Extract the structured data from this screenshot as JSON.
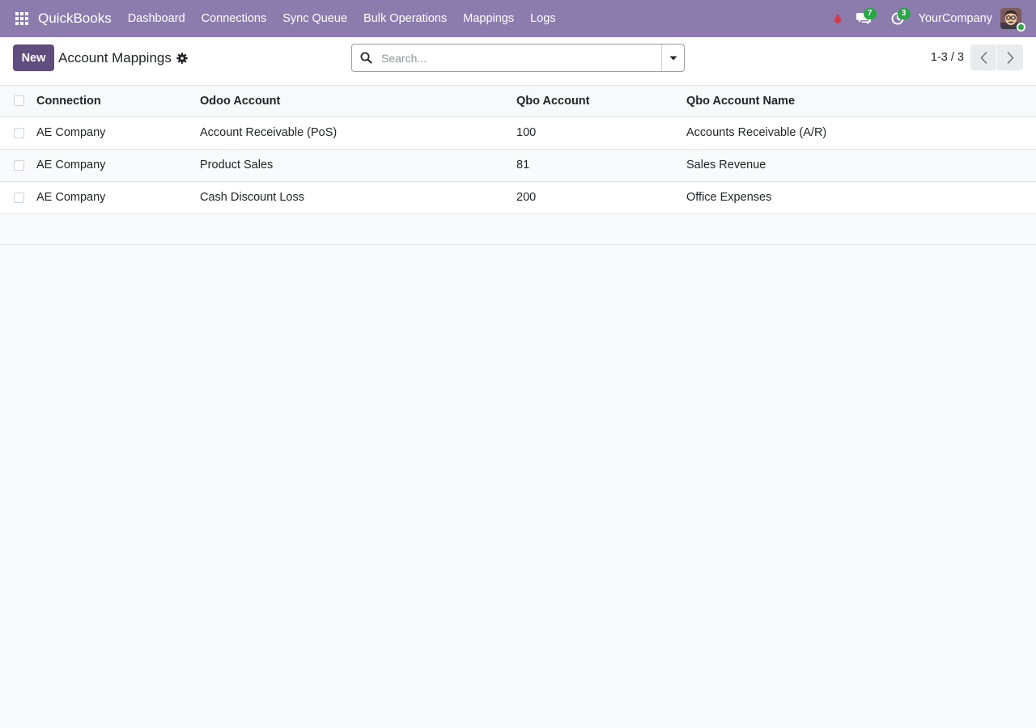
{
  "navbar": {
    "brand": "QuickBooks",
    "menu": [
      {
        "label": "Dashboard"
      },
      {
        "label": "Connections"
      },
      {
        "label": "Sync Queue"
      },
      {
        "label": "Bulk Operations"
      },
      {
        "label": "Mappings"
      },
      {
        "label": "Logs"
      }
    ],
    "messages_count": "7",
    "activities_count": "3",
    "company": "YourCompany",
    "colors": {
      "navbar_bg": "#8c7cae",
      "badge": "#28a745",
      "bug": "#dc3545"
    }
  },
  "control_panel": {
    "new_label": "New",
    "title": "Account Mappings",
    "search_placeholder": "Search...",
    "pager": "1-3 / 3",
    "colors": {
      "primary_button": "#5f4e7e"
    }
  },
  "table": {
    "columns": [
      "Connection",
      "Odoo Account",
      "Qbo Account",
      "Qbo Account Name"
    ],
    "rows": [
      [
        "AE Company",
        "Account Receivable (PoS)",
        "100",
        "Accounts Receivable (A/R)"
      ],
      [
        "AE Company",
        "Product Sales",
        "81",
        "Sales Revenue"
      ],
      [
        "AE Company",
        "Cash Discount Loss",
        "200",
        "Office Expenses"
      ]
    ]
  }
}
